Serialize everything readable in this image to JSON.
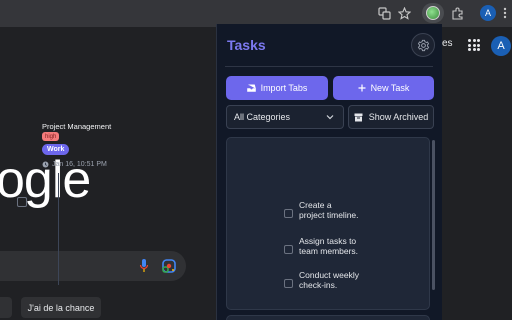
{
  "browser": {
    "account_initial": "A"
  },
  "google_page": {
    "logo_text": "ogle",
    "lucky_button": "J'ai de la chance",
    "header_text": "es",
    "account_initial": "A"
  },
  "extension": {
    "title": "Tasks",
    "import_tabs_label": "Import Tabs",
    "new_task_label": "New Task",
    "category_select": {
      "value": "All Categories"
    },
    "show_archived_label": "Show Archived",
    "task": {
      "title": "Project Management",
      "priority": "high",
      "category": "Work",
      "date": "Jan 16, 10:51 PM",
      "subtasks": [
        {
          "text": "Create a project timeline."
        },
        {
          "text": "Assign tasks to team members."
        },
        {
          "text": "Conduct weekly check-ins."
        }
      ]
    }
  },
  "colors": {
    "accent": "#6d67ec",
    "title": "#7c79f0",
    "high_badge": "#f47b7b",
    "panel_bg": "#111827"
  }
}
